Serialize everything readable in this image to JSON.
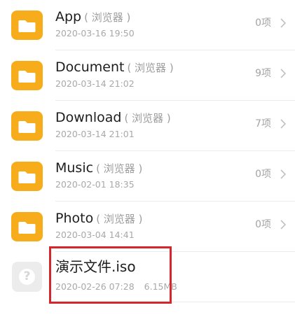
{
  "items": [
    {
      "name": "App",
      "tag": "( 浏览器 )",
      "date": "2020-03-16 19:50",
      "count": "0项",
      "icon": "folder-icon"
    },
    {
      "name": "Document",
      "tag": "( 浏览器 )",
      "date": "2020-03-14 21:02",
      "count": "9项",
      "icon": "folder-icon"
    },
    {
      "name": "Download",
      "tag": "( 浏览器 )",
      "date": "2020-03-14 21:01",
      "count": "7项",
      "icon": "folder-icon"
    },
    {
      "name": "Music",
      "tag": "( 浏览器 )",
      "date": "2020-02-01 18:35",
      "count": "0项",
      "icon": "folder-icon"
    },
    {
      "name": "Photo",
      "tag": "( 浏览器 )",
      "date": "2020-03-04 14:41",
      "count": "0项",
      "icon": "folder-icon"
    }
  ],
  "file": {
    "name": "演示文件.iso",
    "date": "2020-02-26 07:28",
    "size": "6.15MB",
    "icon": "unknown-file-icon",
    "icon_glyph": "?"
  },
  "colors": {
    "folder": "#f7ac1b",
    "highlight": "#d6262c",
    "chevron": "#c2c2c2"
  }
}
